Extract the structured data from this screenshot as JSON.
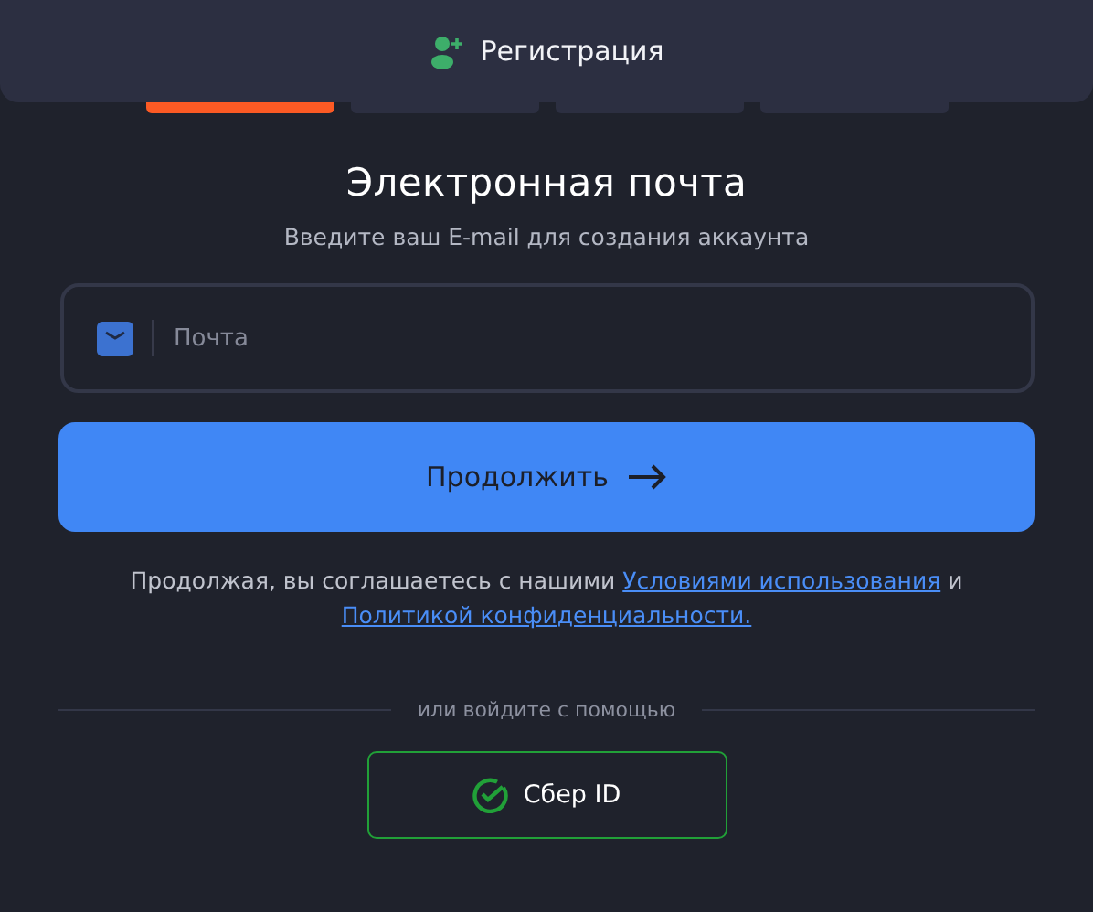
{
  "header": {
    "title": "Регистрация"
  },
  "steps": [
    {
      "active": true
    },
    {
      "active": false
    },
    {
      "active": false
    },
    {
      "active": false
    }
  ],
  "heading": "Электронная почта",
  "subheading": "Введите ваш E-mail для создания аккаунта",
  "email_field": {
    "placeholder": "Почта"
  },
  "continue_button": {
    "label": "Продолжить"
  },
  "terms": {
    "text": "Продолжая, вы соглашаетесь с нашими",
    "link_1": "Условиями использования",
    "conjunction": "и",
    "link_2": "Политикой конфиденциальности."
  },
  "divider": {
    "label": "или войдите с помощью"
  },
  "sber_button": {
    "label": "Сбер ID"
  }
}
